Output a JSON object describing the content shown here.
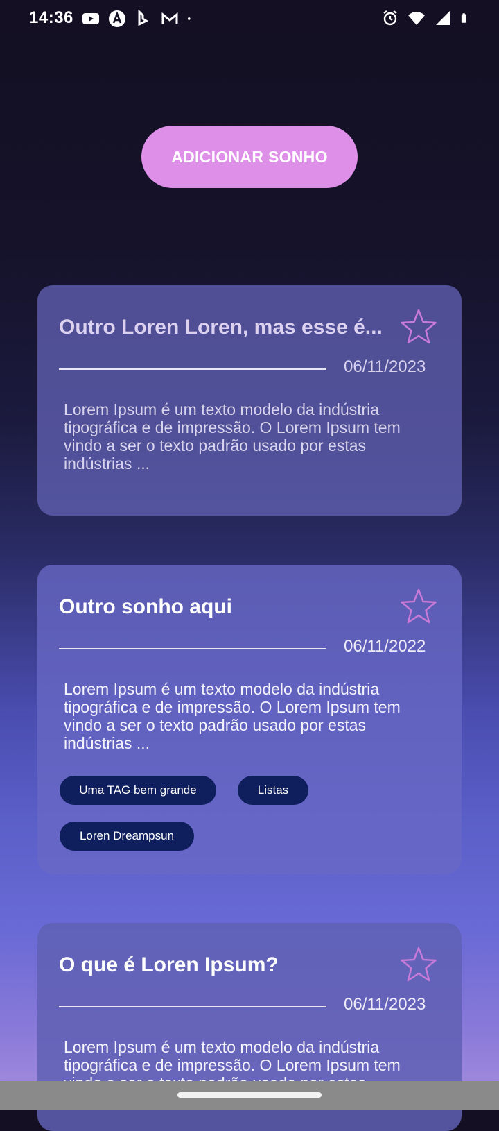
{
  "status_bar": {
    "time": "14:36",
    "left_icons": [
      "youtube-icon",
      "arc-icon",
      "bing-icon",
      "gmail-icon",
      "dot-icon"
    ],
    "right_icons": [
      "alarm-icon",
      "wifi-icon",
      "signal-icon",
      "battery-icon"
    ]
  },
  "add_button_label": "ADICIONAR SONHO",
  "colors": {
    "accent_button": "#de8fe8",
    "star_outline": "#c87ad8",
    "tag_background": "#0f1e5c"
  },
  "cards": [
    {
      "title": "Outro Loren Loren, mas esse é...",
      "date": "06/11/2023",
      "body": "Lorem Ipsum é um texto modelo da indústria tipográfica e de impressão. O Lorem Ipsum tem vindo a ser o texto padrão usado por estas indústrias ...",
      "tags": []
    },
    {
      "title": "Outro sonho aqui",
      "date": "06/11/2022",
      "body": "Lorem Ipsum é um texto modelo da indústria tipográfica e de impressão. O Lorem Ipsum tem vindo a ser o texto padrão usado por estas indústrias ...",
      "tags": [
        "Uma TAG bem grande",
        "Listas",
        "Loren Dreampsun"
      ]
    },
    {
      "title": "O que é Loren Ipsum?",
      "date": "06/11/2023",
      "body": "Lorem Ipsum é um texto modelo da indústria tipográfica e de impressão. O Lorem Ipsum tem vindo a ser o texto padrão usado por estas",
      "tags": []
    }
  ]
}
